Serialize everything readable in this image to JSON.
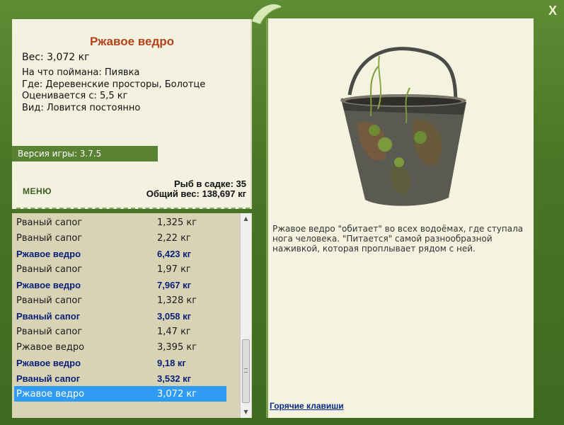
{
  "fish": {
    "title": "Ржавое ведро",
    "weight": "Вес: 3,072 кг",
    "caught_on": "На что поймана: Пиявка",
    "where": "Где: Деревенские просторы, Болотце",
    "valued_from": "Оценивается с: 5,5 кг",
    "kind": "Вид: Ловится постоянно"
  },
  "version": "Версия игры: 3.7.5",
  "menu_label": "МЕНЮ",
  "cage": {
    "count": "Рыб в садке: 35",
    "total": "Общий вес: 138,697 кг"
  },
  "list": [
    {
      "name": "Рваный сапог",
      "weight": "1,325 кг",
      "bold": false
    },
    {
      "name": "Рваный сапог",
      "weight": "2,22 кг",
      "bold": false
    },
    {
      "name": "Ржавое ведро",
      "weight": "6,423 кг",
      "bold": true
    },
    {
      "name": "Рваный сапог",
      "weight": "1,97 кг",
      "bold": false
    },
    {
      "name": "Ржавое ведро",
      "weight": "7,967 кг",
      "bold": true
    },
    {
      "name": "Рваный сапог",
      "weight": "1,328 кг",
      "bold": false
    },
    {
      "name": "Рваный сапог",
      "weight": "3,058 кг",
      "bold": true
    },
    {
      "name": "Рваный сапог",
      "weight": "1,47 кг",
      "bold": false
    },
    {
      "name": "Ржавое ведро",
      "weight": "3,395 кг",
      "bold": false
    },
    {
      "name": "Ржавое ведро",
      "weight": "9,18 кг",
      "bold": true
    },
    {
      "name": "Рваный сапог",
      "weight": "3,532 кг",
      "bold": true
    },
    {
      "name": "Ржавое ведро",
      "weight": "3,072 кг",
      "bold": false,
      "selected": true
    }
  ],
  "description": "Ржавое ведро \"обитает\" во всех водоёмах, где ступала нога человека. \"Питается\" самой разнообразной наживкой, которая проплывает рядом с ней.",
  "hotkeys_label": "Горячие клавиши",
  "colors": {
    "frame": "#4e7a2a",
    "title": "#b3421a",
    "bold_row": "#0b1f7a",
    "selected_row": "#2f9bf2"
  },
  "icons": {
    "close": "close-icon",
    "leaf": "leaf-ornament-icon",
    "scroll_up": "chevron-up-icon",
    "scroll_down": "chevron-down-icon"
  }
}
